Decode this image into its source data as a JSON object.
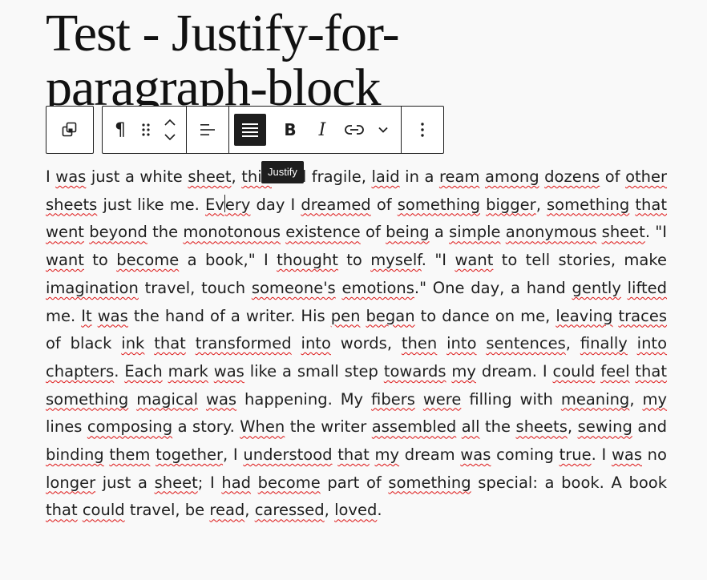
{
  "post": {
    "title": "Test - Justify-for-paragraph-block"
  },
  "toolbar": {
    "tooltip": "Justify",
    "buttons": [
      {
        "name": "parent-block",
        "icon": "overlapping-squares-icon"
      },
      {
        "name": "paragraph",
        "icon": "pilcrow-icon"
      },
      {
        "name": "drag",
        "icon": "drag-handle-icon"
      },
      {
        "name": "move-up",
        "icon": "chevron-up-icon"
      },
      {
        "name": "move-down",
        "icon": "chevron-down-icon"
      },
      {
        "name": "align",
        "icon": "align-left-icon"
      },
      {
        "name": "justify",
        "icon": "justify-icon",
        "active": true
      },
      {
        "name": "bold",
        "icon": "bold-icon"
      },
      {
        "name": "italic",
        "icon": "italic-icon"
      },
      {
        "name": "link",
        "icon": "link-icon"
      },
      {
        "name": "more-formatting",
        "icon": "chevron-down-icon"
      },
      {
        "name": "options",
        "icon": "more-vertical-icon"
      }
    ],
    "glyphs": {
      "pilcrow": "¶",
      "bold": "B",
      "italic": "I"
    }
  },
  "paragraph": {
    "segments": [
      "I ",
      "~was",
      " just a white ",
      "~sheet",
      ", ",
      "~thin",
      " and fragile, ",
      "~laid",
      " in a ",
      "~ream",
      " ",
      "~among",
      " ",
      "~dozens",
      " of ",
      "~other",
      " ",
      "~sheets",
      " just like me. ",
      "~Ev",
      "|",
      "~ery",
      " day I ",
      "~dreamed",
      " of ",
      "~something",
      " ",
      "~bigger",
      ", ",
      "~something",
      " ",
      "~that",
      " ",
      "~went",
      " ",
      "~beyond",
      " the ",
      "~monotonous",
      " ",
      "~existence",
      " of ",
      "~being",
      " a ",
      "~simple",
      " ",
      "~anonymous",
      " ",
      "~sheet",
      ". \"I ",
      "~want",
      " to ",
      "~become",
      " a book,\" I ",
      "~thought",
      " to ",
      "~myself",
      ". ",
      "\"I ",
      "~want",
      " to tell stories, make ",
      "~imagination",
      " travel, touch ",
      "~someone's",
      " ",
      "~emotions",
      ".\" One day, a hand ",
      "~gently",
      " ",
      "~lifted",
      " me. ",
      "~It",
      " ",
      "~was",
      " the hand of a writer. ",
      "His ",
      "~pen",
      " ",
      "~began",
      " to dance on me, ",
      "~leaving",
      " ",
      "~traces",
      " of black ",
      "~ink",
      " ",
      "~that",
      " ",
      "~transformed",
      " ",
      "~into",
      " words, ",
      "~then",
      " ",
      "~into",
      " ",
      "~sentences",
      ", ",
      "~finally",
      " ",
      "~into",
      " ",
      "~chapters",
      ". ",
      "~Each",
      " ",
      "~mark",
      " ",
      "~was",
      " like a small step ",
      "~towards",
      " ",
      "~my",
      " dream. I ",
      "~could",
      " ",
      "~feel",
      " ",
      "~that",
      " ",
      "~something",
      " ",
      "~magical",
      " ",
      "~was",
      " happening. My ",
      "~fibers",
      " ",
      "~were",
      " filling with ",
      "~meaning",
      ", ",
      "~my",
      " lines ",
      "~composing",
      " a story. ",
      "~When",
      " the writer ",
      "~assembled",
      " ",
      "~all",
      " the ",
      "~sheets",
      ", ",
      "~sewing",
      " ",
      "and ",
      "~binding",
      " ",
      "~them",
      " ",
      "~together",
      ", I ",
      "~understood",
      " ",
      "~that",
      " ",
      "~my",
      " dream ",
      "~was",
      " coming ",
      "~true",
      ". ",
      "I ",
      "~was",
      " no ",
      "~longer",
      " just a ",
      "~sheet",
      "; I ",
      "~had",
      " ",
      "~become",
      " part of ",
      "~something",
      " special: a ",
      "book. A book ",
      "~that",
      " ",
      "~could",
      " travel, be ",
      "~read",
      ", ",
      "~caressed",
      ", ",
      "~loved",
      "."
    ]
  }
}
